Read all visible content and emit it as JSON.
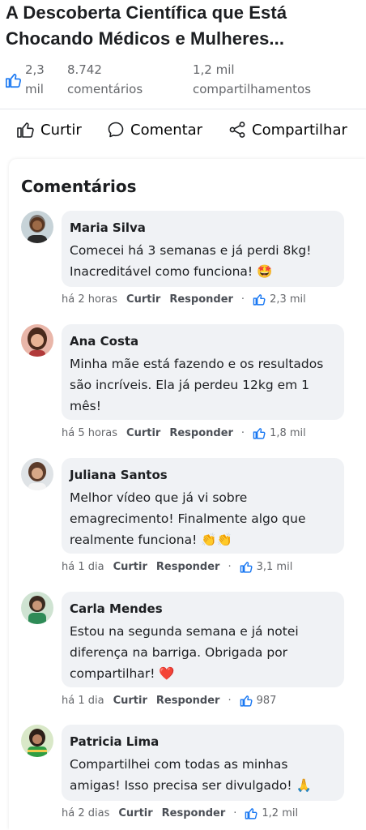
{
  "post": {
    "title": "A Descoberta Científica que Está Chocando Médicos e Mulheres...",
    "stats": {
      "likes_value": "2,3",
      "likes_unit": "mil",
      "comments_value": "8.742",
      "comments_unit": "comentários",
      "shares_value": "1,2 mil",
      "shares_unit": "compartilhamentos"
    },
    "actions": {
      "like_label": "Curtir",
      "comment_label": "Comentar",
      "share_label": "Compartilhar"
    }
  },
  "comments_section": {
    "title": "Comentários",
    "like_label": "Curtir",
    "reply_label": "Responder",
    "items": [
      {
        "name": "Maria Silva",
        "lines": [
          "Comecei há 3 semanas e já perdi 8kg!",
          "Inacreditável como funciona! 🤩"
        ],
        "time": "há 2 horas",
        "likes": "2,3 mil"
      },
      {
        "name": "Ana Costa",
        "lines": [
          "Minha mãe está fazendo e os resultados",
          "são incríveis. Ela já perdeu 12kg em 1",
          "mês!"
        ],
        "time": "há 5 horas",
        "likes": "1,8 mil"
      },
      {
        "name": "Juliana Santos",
        "lines": [
          "Melhor vídeo que já vi sobre",
          "emagrecimento! Finalmente algo que",
          "realmente funciona! 👏👏"
        ],
        "time": "há 1 dia",
        "likes": "3,1 mil"
      },
      {
        "name": "Carla Mendes",
        "lines": [
          "Estou na segunda semana e já notei",
          "diferença na barriga. Obrigada por",
          "compartilhar! ❤️"
        ],
        "time": "há 1 dia",
        "likes": "987"
      },
      {
        "name": "Patricia Lima",
        "lines": [
          "Compartilhei com todas as minhas",
          "amigas! Isso precisa ser divulgado! 🙏"
        ],
        "time": "há 2 dias",
        "likes": "1,2 mil"
      }
    ]
  },
  "colors": {
    "like_blue": "#1877f2",
    "bubble_bg": "#f0f2f5",
    "meta_gray": "#65676b"
  },
  "icons": [
    "thumbs-up-icon",
    "comment-icon",
    "share-icon"
  ]
}
